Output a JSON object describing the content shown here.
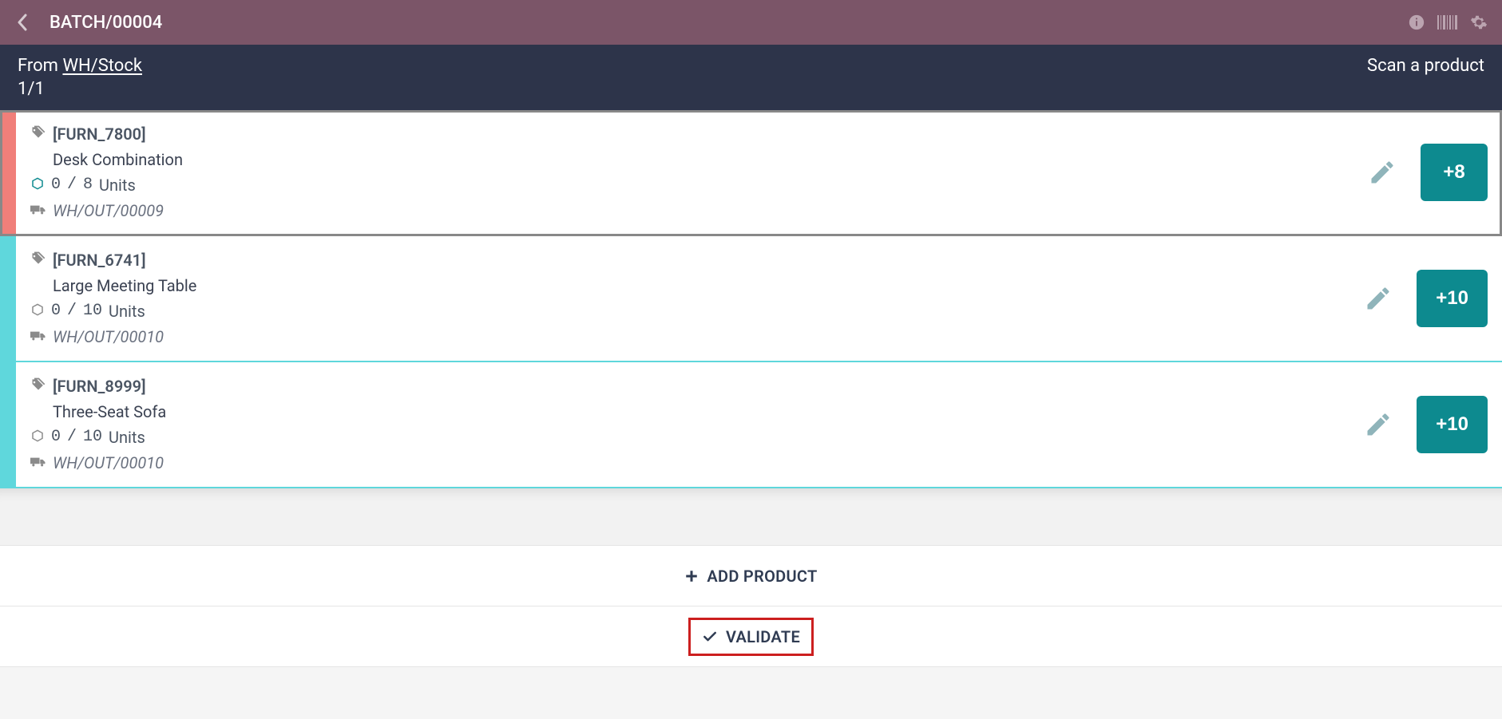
{
  "topbar": {
    "title": "BATCH/00004"
  },
  "subheader": {
    "from_label": "From",
    "location": "WH/Stock",
    "counter": "1/1",
    "scan_label": "Scan a product"
  },
  "rows": [
    {
      "sku": "[FURN_7800]",
      "name": "Desk Combination",
      "done": "0",
      "sep": "/",
      "demand": "8",
      "uom": "Units",
      "ref": "WH/OUT/00009",
      "add_label": "+8",
      "selected": true
    },
    {
      "sku": "[FURN_6741]",
      "name": "Large Meeting Table",
      "done": "0",
      "sep": "/",
      "demand": "10",
      "uom": "Units",
      "ref": "WH/OUT/00010",
      "add_label": "+10",
      "selected": false
    },
    {
      "sku": "[FURN_8999]",
      "name": "Three-Seat Sofa",
      "done": "0",
      "sep": "/",
      "demand": "10",
      "uom": "Units",
      "ref": "WH/OUT/00010",
      "add_label": "+10",
      "selected": false
    }
  ],
  "actions": {
    "add_product": "ADD PRODUCT",
    "validate": "VALIDATE"
  }
}
